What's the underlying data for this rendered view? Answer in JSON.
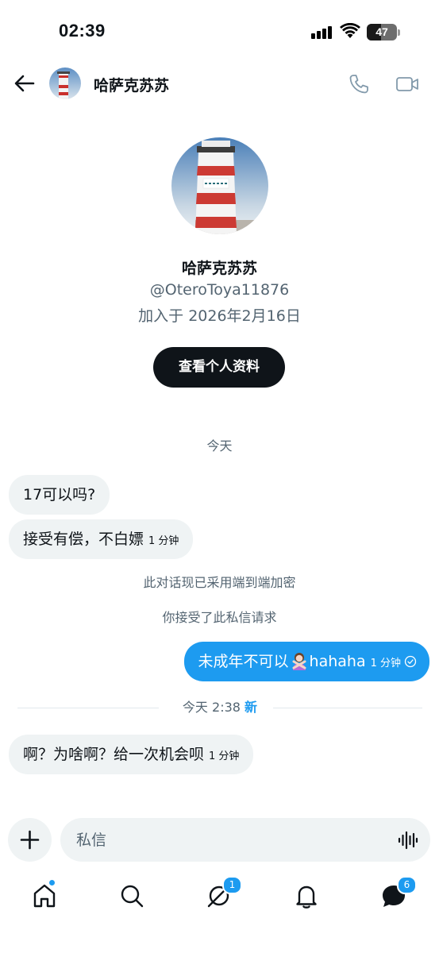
{
  "status_bar": {
    "time": "02:39",
    "battery": "47",
    "battery_level": 0.47
  },
  "header": {
    "name": "哈萨克苏苏"
  },
  "profile": {
    "name": "哈萨克苏苏",
    "handle": "@OteroToya11876",
    "joined": "加入于 2026年2月16日",
    "view_profile_label": "查看个人资料"
  },
  "conversation": {
    "day_label": "今天",
    "incoming_1": {
      "text": "17可以吗?"
    },
    "incoming_2": {
      "text": "接受有偿，不白嫖",
      "time": "1 分钟"
    },
    "encryption_note": "此对话现已采用端到端加密",
    "accepted_note": "你接受了此私信请求",
    "outgoing_1": {
      "text_before": "未成年不可以",
      "emoji": "person-gesturing-no-emoji",
      "text_after": "hahaha",
      "time": "1 分钟"
    },
    "divider": {
      "time": "今天 2:38",
      "new_label": "新"
    },
    "incoming_3": {
      "text": "啊？为啥啊？给一次机会呗",
      "time": "1 分钟"
    }
  },
  "composer": {
    "placeholder": "私信"
  },
  "bottom_nav": {
    "home_icon": "home-icon",
    "search_icon": "search-icon",
    "grok_icon": "slash-circle-icon",
    "grok_badge": "1",
    "notifications_icon": "bell-icon",
    "messages_icon": "messages-icon",
    "messages_badge": "6"
  },
  "colors": {
    "accent": "#1d9bf0",
    "text": "#0f1419",
    "muted": "#536471",
    "bubble": "#eff3f4"
  }
}
